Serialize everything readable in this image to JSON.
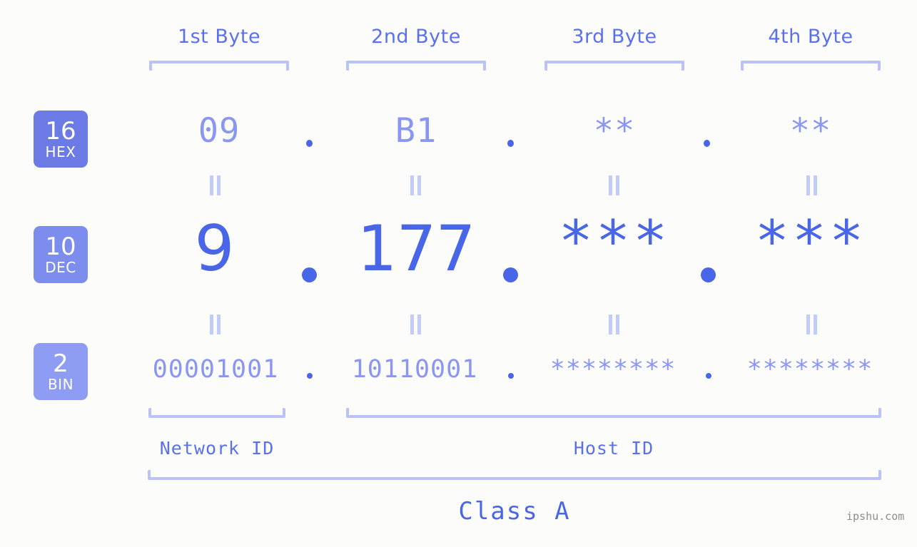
{
  "background_color": "#fcfdfa",
  "accent_color": "#4a66e8",
  "accent_light_color": "#8a96f2",
  "bracket_color": "#b9c2fb",
  "byte_headers": [
    {
      "label": "1st Byte"
    },
    {
      "label": "2nd Byte"
    },
    {
      "label": "3rd Byte"
    },
    {
      "label": "4th Byte"
    }
  ],
  "rows": [
    {
      "radix": "16",
      "radix_name": "HEX",
      "badge_color": "#6b7ae4",
      "values": [
        "09",
        "B1",
        "**",
        "**"
      ]
    },
    {
      "radix": "10",
      "radix_name": "DEC",
      "badge_color": "#7d8ded",
      "values": [
        "9",
        "177",
        "***",
        "***"
      ]
    },
    {
      "radix": "2",
      "radix_name": "BIN",
      "badge_color": "#8e9df3",
      "values": [
        "00001001",
        "10110001",
        "********",
        "********"
      ]
    }
  ],
  "separator": ".",
  "equals_symbol": "=",
  "segments": {
    "network_id": "Network ID",
    "host_id": "Host ID",
    "class": "Class A"
  },
  "watermark": "ipshu.com"
}
